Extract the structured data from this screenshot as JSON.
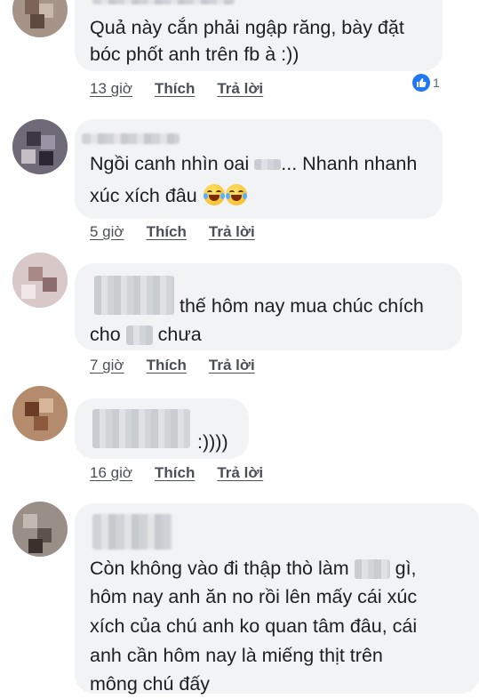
{
  "comments": [
    {
      "text_lines": [
        "Quả này cắn phải ngập răng, bày đặt",
        "bóc phốt anh trên fb à :))"
      ],
      "time": "13 giờ",
      "like": "Thích",
      "reply": "Trả lời",
      "reaction_count": "1"
    },
    {
      "text_lines": [
        "Ngồi canh nhìn oai",
        "... Nhanh nhanh",
        "xúc xích đâu"
      ],
      "time": "5 giờ",
      "like": "Thích",
      "reply": "Trả lời"
    },
    {
      "text_lines": [
        "thế hôm nay mua chúc chích",
        "cho",
        "chưa"
      ],
      "time": "7 giờ",
      "like": "Thích",
      "reply": "Trả lời"
    },
    {
      "text_lines": [
        ":))))"
      ],
      "time": "16 giờ",
      "like": "Thích",
      "reply": "Trả lời"
    },
    {
      "text_lines": [
        "Còn không vào đi thập thò làm",
        "gì,",
        "hôm nay anh ăn no rồi lên mấy cái xúc",
        "xích của chú anh ko quan tâm đâu, cái",
        "anh cần hôm nay là miếng thịt trên",
        "mông chú đấy"
      ]
    }
  ],
  "colors": {
    "bubble": "#f2f3f5",
    "text": "#1c1e21",
    "meta": "#4b4f56",
    "like_badge": "#2078f4"
  },
  "icons": {
    "reaction": "like-icon",
    "emoji": "tears-of-joy-emoji"
  }
}
